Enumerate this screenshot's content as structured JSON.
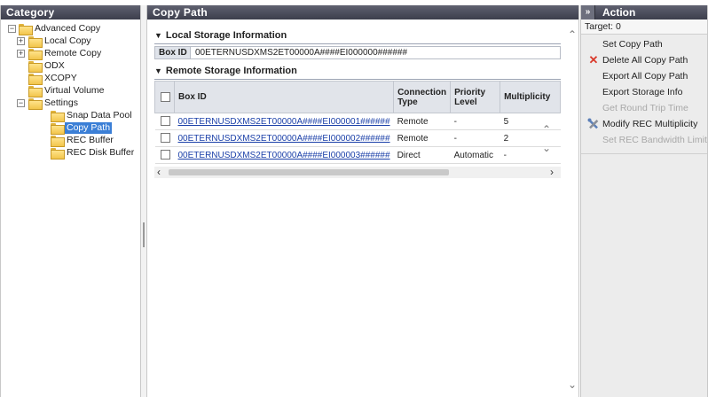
{
  "category": {
    "title": "Category",
    "tree": [
      {
        "label": "Advanced Copy",
        "expander": "−"
      },
      {
        "label": "Local Copy",
        "expander": "+"
      },
      {
        "label": "Remote Copy",
        "expander": "+"
      },
      {
        "label": "ODX"
      },
      {
        "label": "XCOPY"
      },
      {
        "label": "Virtual Volume"
      },
      {
        "label": "Settings",
        "expander": "−"
      },
      {
        "label": "Snap Data Pool"
      },
      {
        "label": "Copy Path",
        "selected": true
      },
      {
        "label": "REC Buffer"
      },
      {
        "label": "REC Disk Buffer"
      }
    ]
  },
  "main": {
    "title": "Copy Path",
    "local": {
      "title": "Local Storage Information",
      "key": "Box ID",
      "value": "00ETERNUSDXMS2ET00000A####EI000000######"
    },
    "remote": {
      "title": "Remote Storage Information",
      "columns": [
        "Box ID",
        "Connection Type",
        "Priority Level",
        "Multiplicity"
      ],
      "rows": [
        {
          "box_id": "00ETERNUSDXMS2ET00000A####EI000001######",
          "connection": "Remote",
          "priority": "-",
          "multiplicity": "5"
        },
        {
          "box_id": "00ETERNUSDXMS2ET00000A####EI000002######",
          "connection": "Remote",
          "priority": "-",
          "multiplicity": "2"
        },
        {
          "box_id": "00ETERNUSDXMS2ET00000A####EI000003######",
          "connection": "Direct",
          "priority": "Automatic",
          "multiplicity": "-"
        }
      ]
    }
  },
  "action": {
    "collapse_glyph": "»",
    "title": "Action",
    "target": "Target: 0",
    "items": [
      {
        "label": "Set Copy Path",
        "icon": "",
        "enabled": true
      },
      {
        "label": "Delete All Copy Path",
        "icon": "delete-x-icon",
        "enabled": true
      },
      {
        "label": "Export All Copy Path",
        "icon": "",
        "enabled": true
      },
      {
        "label": "Export Storage Info",
        "icon": "",
        "enabled": true
      },
      {
        "label": "Get Round Trip Time",
        "icon": "",
        "enabled": false
      },
      {
        "label": "Modify REC Multiplicity",
        "icon": "tools-icon",
        "enabled": true
      },
      {
        "label": "Set REC Bandwidth Limit",
        "icon": "",
        "enabled": false
      }
    ]
  },
  "colors": {
    "header_bg": "#4a4c5a",
    "selected_bg": "#3b7fd6",
    "link": "#1a3fa8",
    "delete_icon": "#d93a2b"
  }
}
